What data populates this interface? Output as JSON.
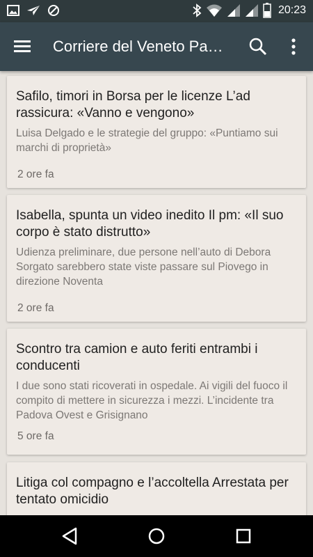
{
  "status_bar": {
    "time": "20:23",
    "left_icons": [
      "image-icon",
      "send-icon",
      "blocked-icon"
    ],
    "right_icons": [
      "bluetooth-icon",
      "wifi-icon",
      "signal-icon",
      "signal-icon",
      "battery-icon"
    ]
  },
  "app_bar": {
    "title": "Corriere del Veneto Padova",
    "icons": [
      "menu-icon",
      "search-icon",
      "more-vert-icon"
    ]
  },
  "articles": [
    {
      "headline": "Safilo, timori in Borsa per le licenze L’ad rassicura: «Vanno e vengono»",
      "summary": "Luisa Delgado e le strategie del gruppo: «Puntiamo sui marchi di proprietà»",
      "time": "2 ore fa"
    },
    {
      "headline": "Isabella, spunta un video inedito Il pm: «Il suo corpo è stato distrutto»",
      "summary": "Udienza preliminare, due persone nell’auto di Debora Sorgato sarebbero state viste passare sul Piovego in direzione Noventa",
      "time": "2 ore fa"
    },
    {
      "headline": "Scontro tra camion e auto feriti entrambi i conducenti",
      "summary": "I due sono stati ricoverati in ospedale. Ai vigili del fuoco il compito di mettere in sicurezza i mezzi. L’incidente tra Padova Ovest e Grisignano",
      "time": "5 ore fa"
    },
    {
      "headline": "Litiga col compagno e l’accoltella Arrestata per tentato omicidio",
      "summary": "",
      "time": ""
    }
  ],
  "nav_bar": {
    "icons": [
      "back-icon",
      "home-icon",
      "recents-icon"
    ]
  },
  "colors": {
    "status_bar": "#2f3a3d",
    "app_bar": "#37474f",
    "background": "#e6e2dd",
    "card": "#efeae5",
    "headline": "#1f1f1f",
    "summary": "#7c7875"
  }
}
